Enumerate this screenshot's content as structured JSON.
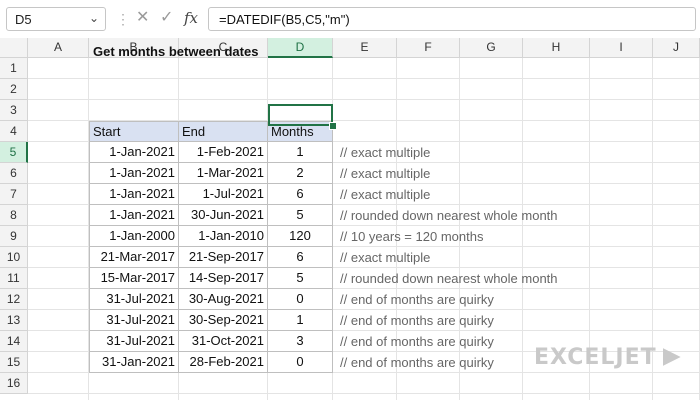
{
  "formula_bar": {
    "name_box": "D5",
    "cancel_icon": "✕",
    "enter_icon": "✓",
    "fx_label": "fx",
    "formula": "=DATEDIF(B5,C5,\"m\")"
  },
  "columns": [
    "A",
    "B",
    "C",
    "D",
    "E",
    "F",
    "G",
    "H",
    "I",
    "J"
  ],
  "active_column": "D",
  "rows": [
    "1",
    "2",
    "3",
    "4",
    "5",
    "6",
    "7",
    "8",
    "9",
    "10",
    "11",
    "12",
    "13",
    "14",
    "15",
    "16"
  ],
  "active_row": "5",
  "sheet": {
    "title": "Get months between dates",
    "headers": [
      "Start",
      "End",
      "Months"
    ],
    "data": [
      {
        "start": "1-Jan-2021",
        "end": "1-Feb-2021",
        "months": "1",
        "comment": "// exact multiple"
      },
      {
        "start": "1-Jan-2021",
        "end": "1-Mar-2021",
        "months": "2",
        "comment": "// exact multiple"
      },
      {
        "start": "1-Jan-2021",
        "end": "1-Jul-2021",
        "months": "6",
        "comment": "// exact multiple"
      },
      {
        "start": "1-Jan-2021",
        "end": "30-Jun-2021",
        "months": "5",
        "comment": "// rounded down nearest whole month"
      },
      {
        "start": "1-Jan-2000",
        "end": "1-Jan-2010",
        "months": "120",
        "comment": "// 10 years = 120 months"
      },
      {
        "start": "21-Mar-2017",
        "end": "21-Sep-2017",
        "months": "6",
        "comment": "// exact multiple"
      },
      {
        "start": "15-Mar-2017",
        "end": "14-Sep-2017",
        "months": "5",
        "comment": "// rounded down nearest whole month"
      },
      {
        "start": "31-Jul-2021",
        "end": "30-Aug-2021",
        "months": "0",
        "comment": "// end of months are quirky"
      },
      {
        "start": "31-Jul-2021",
        "end": "30-Sep-2021",
        "months": "1",
        "comment": "// end of months are quirky"
      },
      {
        "start": "31-Jul-2021",
        "end": "31-Oct-2021",
        "months": "3",
        "comment": "// end of months are quirky"
      },
      {
        "start": "31-Jan-2021",
        "end": "28-Feb-2021",
        "months": "0",
        "comment": "// end of months are quirky"
      }
    ]
  },
  "logo": "EXCELJET",
  "colors": {
    "accent": "#217346",
    "header_fill": "#d9e1f2"
  }
}
